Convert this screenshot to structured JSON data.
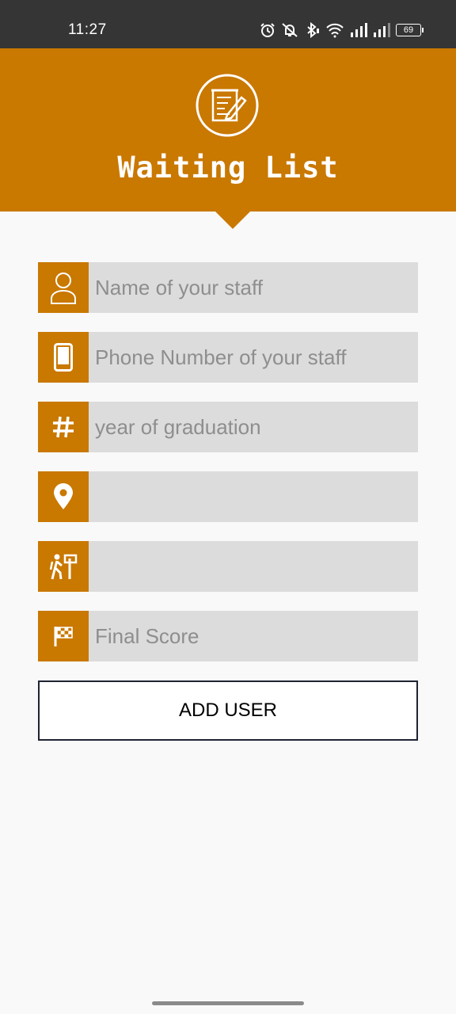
{
  "status_bar": {
    "time": "11:27",
    "battery": "69",
    "icons": [
      "alarm-icon",
      "mute-icon",
      "bluetooth-icon",
      "wifi-icon",
      "signal-icon",
      "signal-icon-2",
      "battery-icon"
    ]
  },
  "header": {
    "title": "Waiting List",
    "logo_icon": "notepad-pencil-icon",
    "color": "#c97800"
  },
  "form": {
    "fields": [
      {
        "icon": "person-icon",
        "placeholder": "Name of your staff",
        "value": ""
      },
      {
        "icon": "phone-icon",
        "placeholder": "Phone Number of your staff",
        "value": ""
      },
      {
        "icon": "hash-icon",
        "placeholder": "year of graduation",
        "value": ""
      },
      {
        "icon": "location-pin-icon",
        "placeholder": "",
        "value": ""
      },
      {
        "icon": "hiker-signpost-icon",
        "placeholder": "",
        "value": ""
      },
      {
        "icon": "checkered-flag-icon",
        "placeholder": "Final Score",
        "value": ""
      }
    ],
    "submit_label": "ADD USER"
  }
}
